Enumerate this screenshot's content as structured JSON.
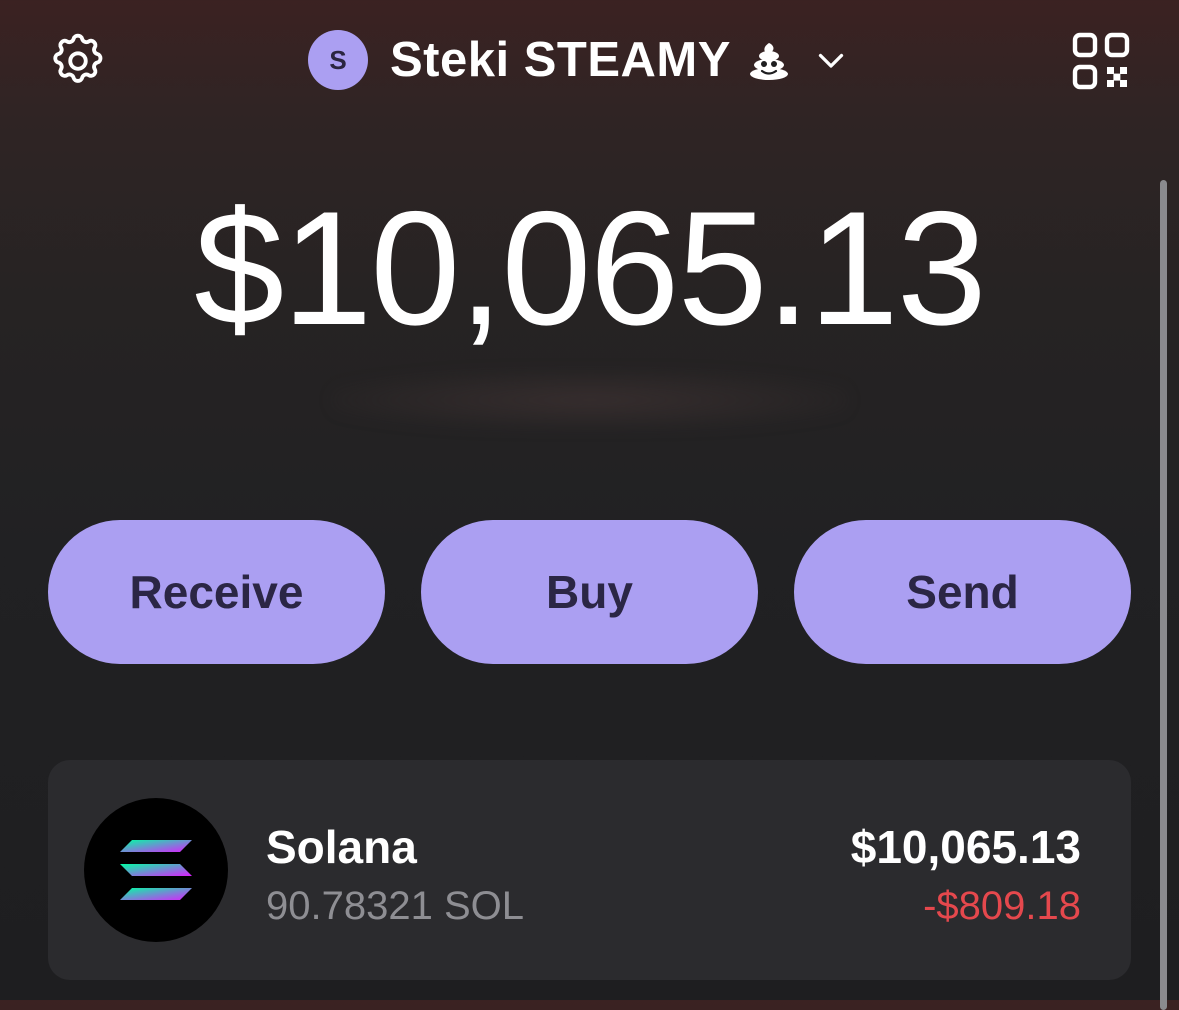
{
  "header": {
    "avatar_letter": "S",
    "account_name": "Steki STEAMY",
    "account_emoji_icon": "poop-emoji-icon",
    "settings_icon": "gear-icon",
    "switch_icon": "chevron-down-icon",
    "qr_icon": "qr-code-icon"
  },
  "balance": {
    "total": "$10,065.13"
  },
  "actions": {
    "receive_label": "Receive",
    "buy_label": "Buy",
    "send_label": "Send"
  },
  "tokens": [
    {
      "name": "Solana",
      "amount": "90.78321 SOL",
      "value": "$10,065.13",
      "change": "-$809.18",
      "logo_icon": "solana-logo-icon"
    }
  ],
  "colors": {
    "accent": "#ab9ff2",
    "button_text": "#2b2645",
    "negative": "#e5484d",
    "muted_text": "#8e8e93",
    "card_bg": "#2b2b2e"
  }
}
